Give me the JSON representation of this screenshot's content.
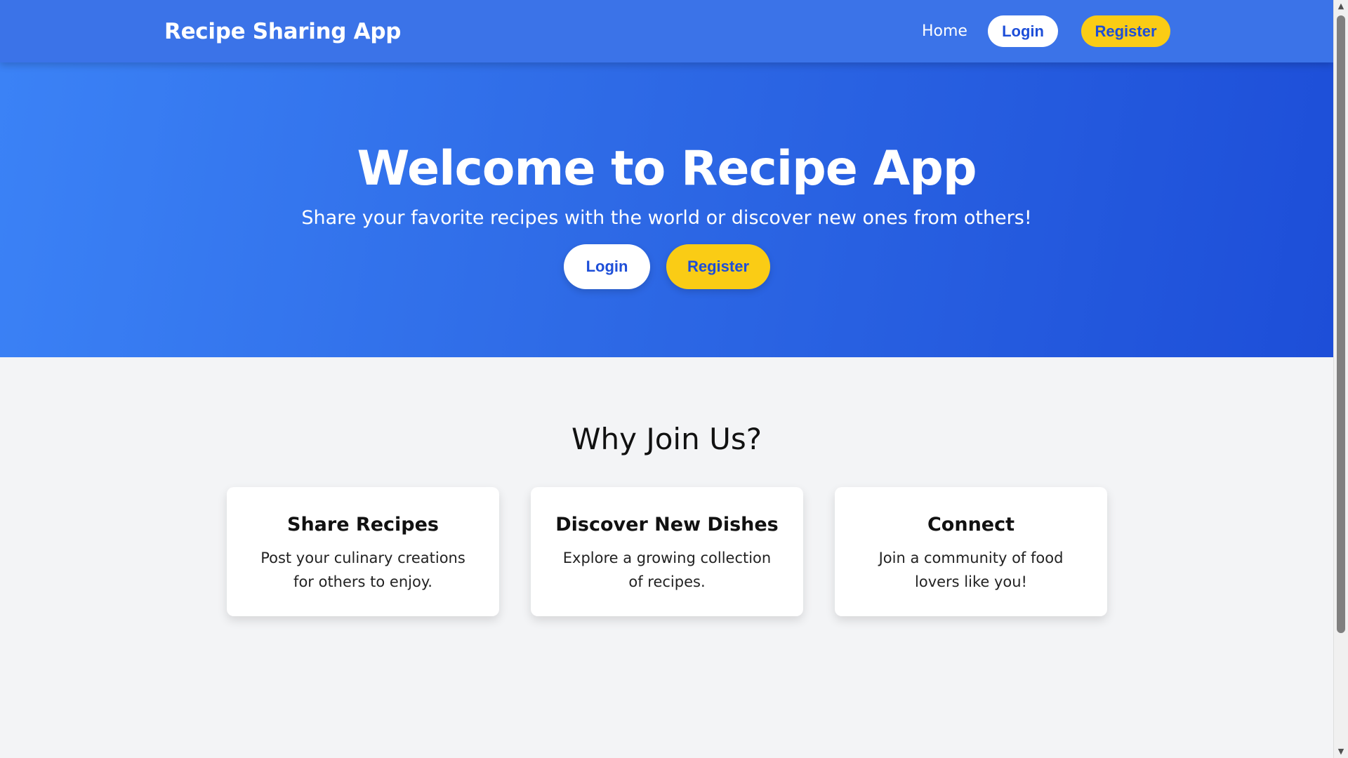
{
  "navbar": {
    "brand": "Recipe Sharing App",
    "links": {
      "home": "Home",
      "login": "Login",
      "register": "Register"
    }
  },
  "hero": {
    "title": "Welcome to Recipe App",
    "subtitle": "Share your favorite recipes with the world or discover new ones from others!",
    "login_label": "Login",
    "register_label": "Register"
  },
  "features": {
    "title": "Why Join Us?",
    "cards": [
      {
        "title": "Share Recipes",
        "text": "Post your culinary creations for others to enjoy."
      },
      {
        "title": "Discover New Dishes",
        "text": "Explore a growing collection of recipes."
      },
      {
        "title": "Connect",
        "text": "Join a community of food lovers like you!"
      }
    ]
  },
  "scrollbar": {
    "up_icon": "▲",
    "down_icon": "▼"
  },
  "colors": {
    "primary": "#3b73e8",
    "hero_gradient_start": "#3b82f6",
    "hero_gradient_end": "#1d4ed8",
    "accent": "#facc15",
    "button_text": "#1d4ed8",
    "background": "#f3f4f6"
  }
}
